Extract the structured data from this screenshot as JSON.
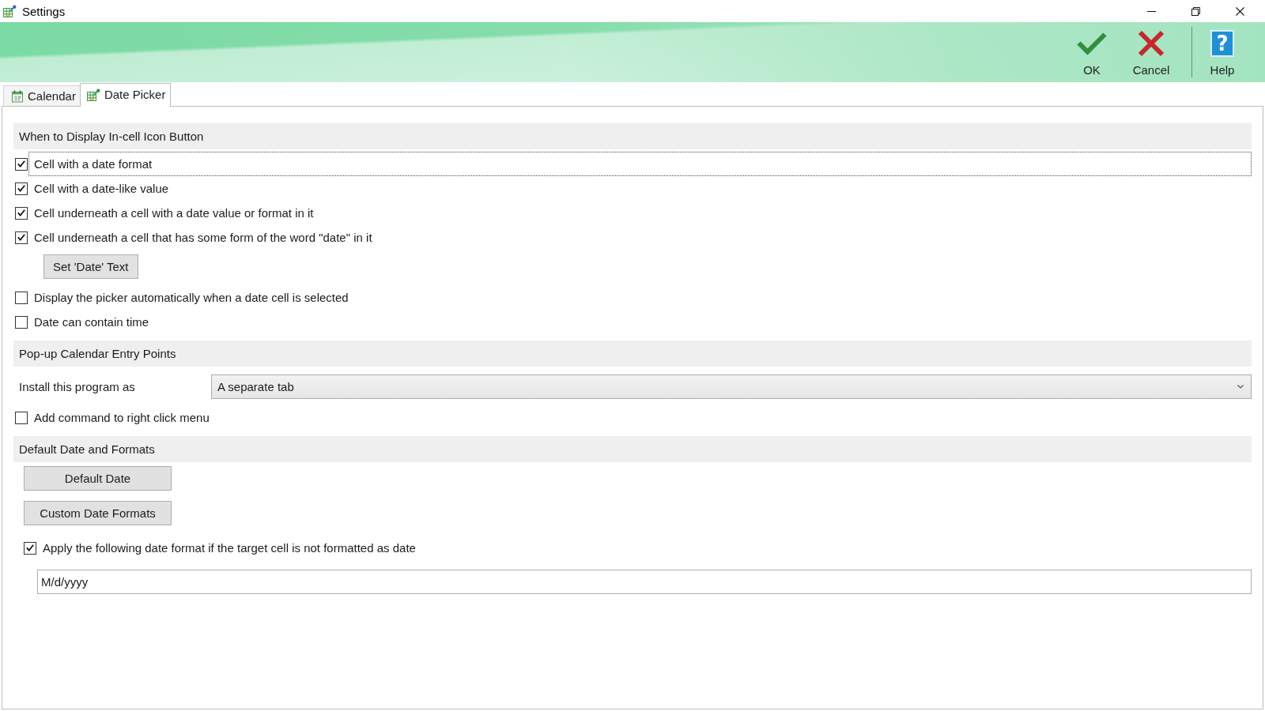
{
  "window": {
    "title": "Settings"
  },
  "toolbar": {
    "buttons": [
      {
        "kind": "ok",
        "label": "OK"
      },
      {
        "kind": "cancel",
        "label": "Cancel"
      },
      {
        "kind": "help",
        "label": "Help",
        "glyph": "?"
      }
    ]
  },
  "tabs": [
    {
      "kind": "calendar",
      "label": "Calendar",
      "selected": false
    },
    {
      "kind": "picker",
      "label": "Date Picker",
      "selected": true
    }
  ],
  "sections": [
    {
      "title": "When to Display In-cell Icon Button",
      "items": [
        {
          "kind": "checkbox",
          "label": "Cell with a date format",
          "checked": true,
          "focused": true
        },
        {
          "kind": "checkbox",
          "label": "Cell with a date-like value",
          "checked": true,
          "focused": false
        },
        {
          "kind": "checkbox",
          "label": "Cell underneath a cell with a date value or format in it",
          "checked": true,
          "focused": false
        },
        {
          "kind": "checkbox",
          "label": "Cell underneath a cell that has some form of the word \"date\" in it",
          "checked": true,
          "focused": false,
          "children": [
            {
              "kind": "button",
              "label": "Set 'Date' Text"
            }
          ]
        },
        {
          "kind": "checkbox",
          "label": "Display the picker automatically when a date cell is selected",
          "checked": false,
          "focused": false
        },
        {
          "kind": "checkbox",
          "label": "Date can contain time",
          "checked": false,
          "focused": false
        }
      ]
    },
    {
      "title": "Pop-up Calendar Entry Points",
      "items": [
        {
          "kind": "dropdown",
          "label": "Install this program as",
          "value": "A separate tab"
        },
        {
          "kind": "checkbox",
          "label": "Add command to right click menu",
          "checked": false,
          "focused": false
        }
      ]
    },
    {
      "title": "Default Date and Formats",
      "items": [
        {
          "kind": "button",
          "label": "Default Date"
        },
        {
          "kind": "button",
          "label": "Custom Date Formats"
        },
        {
          "kind": "checkbox",
          "label": "Apply the following date format if the target cell is not formatted as date",
          "checked": true,
          "focused": false,
          "children": [
            {
              "kind": "text-field",
              "value": "M/d/yyyy"
            }
          ]
        }
      ]
    }
  ]
}
